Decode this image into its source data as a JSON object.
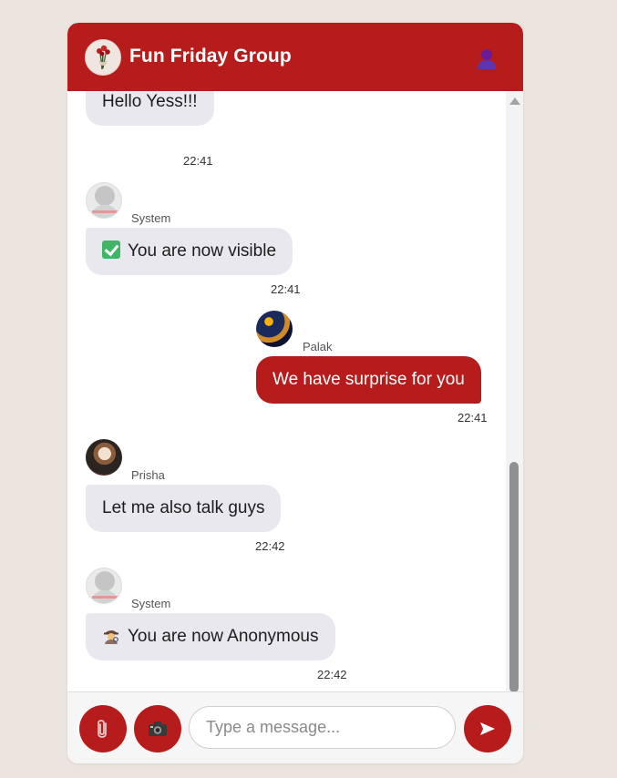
{
  "header": {
    "title": "Fun Friday Group",
    "group_avatar_icon": "group-photo-icon",
    "member_icon": "user-icon"
  },
  "messages": [
    {
      "type": "received",
      "sender": "",
      "text": "Hello Yess!!!",
      "time": "22:41",
      "avatar": ""
    },
    {
      "type": "received",
      "sender": "System",
      "text": "You are now visible",
      "emoji": "check-mark-icon",
      "time": "22:41",
      "avatar": "system-avatar"
    },
    {
      "type": "sent",
      "sender": "Palak",
      "text": "We have surprise for you",
      "time": "22:41",
      "avatar": "palak-avatar"
    },
    {
      "type": "received",
      "sender": "Prisha",
      "text": "Let me also talk guys",
      "time": "22:42",
      "avatar": "prisha-avatar"
    },
    {
      "type": "received",
      "sender": "System",
      "text": "You are now Anonymous",
      "emoji": "detective-icon",
      "time": "22:42",
      "avatar": "system-avatar"
    }
  ],
  "composer": {
    "placeholder": "Type a message...",
    "attach_icon": "paperclip-icon",
    "camera_icon": "camera-icon",
    "send_icon": "send-icon"
  },
  "colors": {
    "brand": "#b71c1c",
    "page_background": "#ece5df",
    "received_bubble": "#e8e8ee"
  }
}
